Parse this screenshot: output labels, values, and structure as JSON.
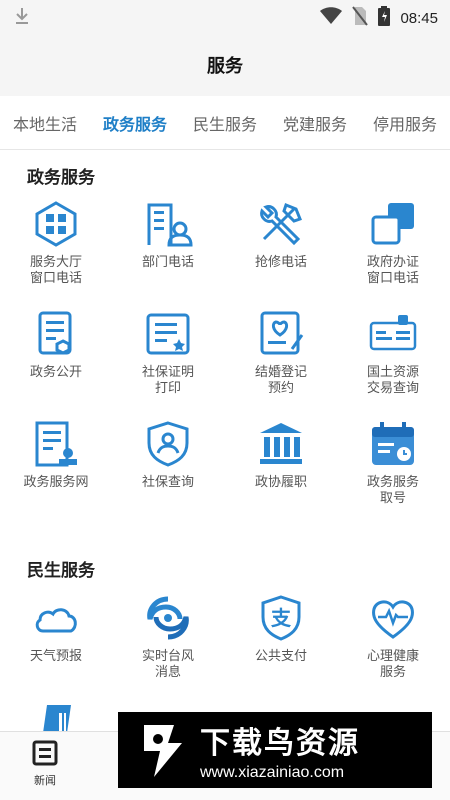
{
  "status": {
    "time": "08:45"
  },
  "header": {
    "title": "服务"
  },
  "tabs": [
    {
      "label": "本地生活"
    },
    {
      "label": "政务服务"
    },
    {
      "label": "民生服务"
    },
    {
      "label": "党建服务"
    },
    {
      "label": "停用服务"
    }
  ],
  "gov_section": {
    "title": "政务服务",
    "items": [
      {
        "label": "服务大厅\n窗口电话",
        "icon": "grid-building-icon"
      },
      {
        "label": "部门电话",
        "icon": "department-icon"
      },
      {
        "label": "抢修电话",
        "icon": "repair-tools-icon"
      },
      {
        "label": "政府办证\n窗口电话",
        "icon": "certificate-window-icon"
      },
      {
        "label": "政务公开",
        "icon": "document-icon"
      },
      {
        "label": "社保证明\n打印",
        "icon": "social-cert-icon"
      },
      {
        "label": "结婚登记\n预约",
        "icon": "marriage-icon"
      },
      {
        "label": "国土资源\n交易查询",
        "icon": "land-resource-icon"
      },
      {
        "label": "政务服务网",
        "icon": "gov-web-icon"
      },
      {
        "label": "社保查询",
        "icon": "social-shield-icon"
      },
      {
        "label": "政协履职",
        "icon": "building-columns-icon"
      },
      {
        "label": "政务服务\n取号",
        "icon": "calendar-clock-icon"
      }
    ]
  },
  "life_section": {
    "title": "民生服务",
    "items": [
      {
        "label": "天气预报",
        "icon": "cloud-icon"
      },
      {
        "label": "实时台风\n消息",
        "icon": "typhoon-icon"
      },
      {
        "label": "公共支付",
        "icon": "alipay-icon"
      },
      {
        "label": "心理健康\n服务",
        "icon": "heart-pulse-icon"
      }
    ]
  },
  "bottom_nav": {
    "news_label": "新闻"
  },
  "watermark": {
    "text": "下载鸟资源",
    "url": "www.xiazainiao.com"
  },
  "colors": {
    "accent": "#1f7fc7",
    "icon": "#2a86cf"
  }
}
